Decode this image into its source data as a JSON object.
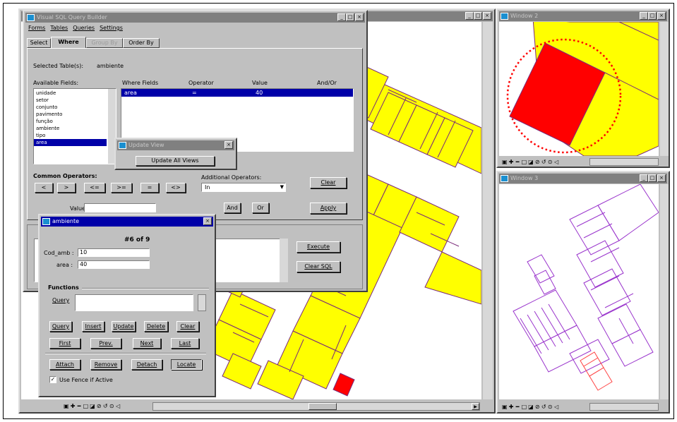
{
  "main_window": {
    "title": "Visual SQL Query Builder",
    "menu": [
      "Forms",
      "Tables",
      "Queries",
      "Settings"
    ],
    "tabs": [
      "Select",
      "Where",
      "Group By",
      "Order By"
    ],
    "selected_tables_label": "Selected Table(s):",
    "selected_table_value": "ambiente",
    "available_fields_label": "Available Fields:",
    "available_fields": [
      "unidade",
      "setor",
      "conjunto",
      "pavimento",
      "função",
      "ambiente",
      "tipo",
      "area"
    ],
    "where_headers": [
      "Where Fields",
      "Operator",
      "Value",
      "And/Or"
    ],
    "where_row": {
      "field": "area",
      "operator": "=",
      "value": "40",
      "andor": ""
    },
    "common_operators_label": "Common Operators:",
    "operators": [
      "<",
      ">",
      "<=",
      ">=",
      "=",
      "<>"
    ],
    "additional_operators_label": "Additional Operators:",
    "additional_operator_value": "In",
    "value_label": "Value",
    "value_input": "",
    "and_label": "And",
    "or_label": "Or",
    "clear_label": "Clear",
    "apply_label": "Apply",
    "execute_label": "Execute",
    "clear_sql_label": "Clear SQL"
  },
  "update_view_dialog": {
    "title": "Update View",
    "button_label": "Update All Views"
  },
  "ambiente_dialog": {
    "title": "ambiente",
    "record_counter": "#6 of 9",
    "field1_label": "Cod_amb :",
    "field1_value": "10",
    "field2_label": "area :",
    "field2_value": "40",
    "functions_label": "Functions",
    "query_label": "Query",
    "row1": [
      "Query",
      "Insert",
      "Update",
      "Delete",
      "Clear"
    ],
    "row2": [
      "First",
      "Prev.",
      "Next",
      "Last"
    ],
    "row3": [
      "Attach",
      "Remove",
      "Detach",
      "Locate"
    ],
    "checkbox_label": "Use Fence if Active",
    "checkbox_mark": "✓"
  },
  "map_window_1": {
    "toolbar": [
      "▣",
      "✚",
      "━",
      "□",
      "◪",
      "⊘",
      "↺",
      "⊙",
      "◁"
    ]
  },
  "window2": {
    "title": "Window 2",
    "toolbar": [
      "▣",
      "✚",
      "━",
      "□",
      "◪",
      "⊘",
      "↺",
      "⊙",
      "◁"
    ]
  },
  "window3": {
    "title": "Window 3",
    "toolbar": [
      "▣",
      "✚",
      "━",
      "□",
      "◪",
      "⊘",
      "↺",
      "⊙",
      "◁"
    ]
  },
  "titlebar_glyphs": {
    "min": "_",
    "max": "□",
    "close": "×"
  },
  "scroll_glyphs": {
    "up": "▲",
    "down": "▼",
    "left": "◀",
    "right": "▶"
  },
  "colors": {
    "building_fill": "#ffff00",
    "building_outline": "#7a2a7a",
    "selected_fill": "#ff0000",
    "wireframe": "#9933cc",
    "title_active": "#0000a8",
    "title_inactive": "#808080"
  }
}
